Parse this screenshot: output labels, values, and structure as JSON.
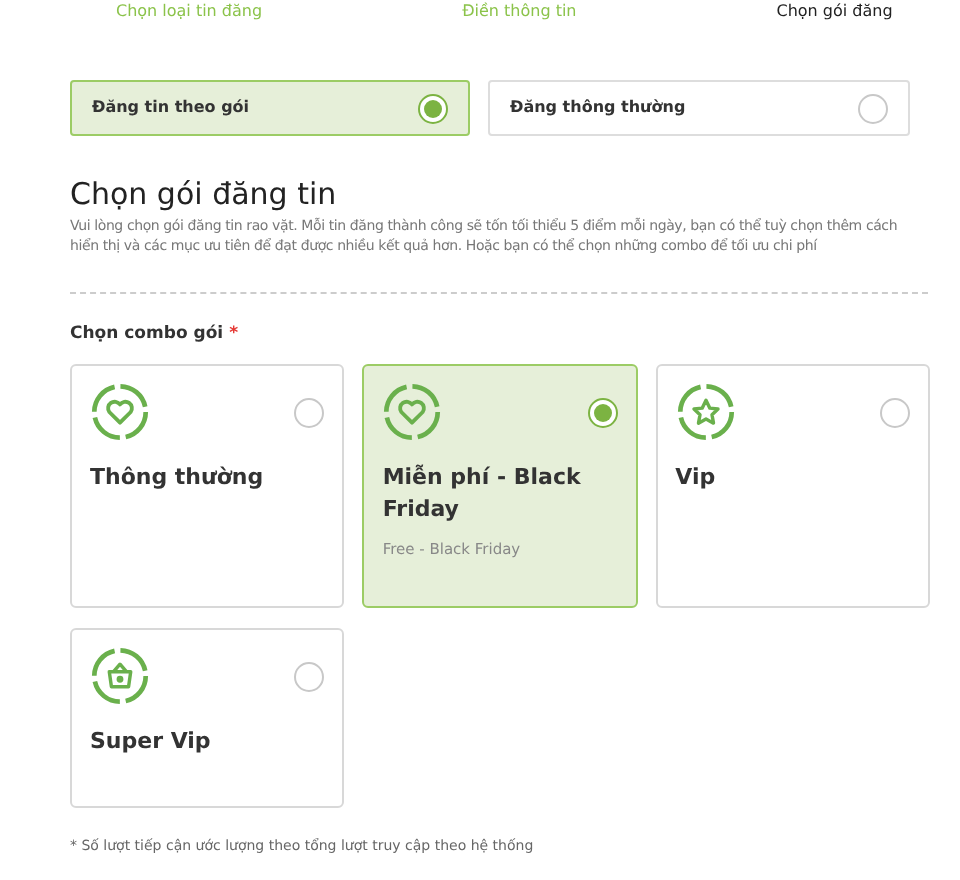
{
  "steps": [
    {
      "label": "Chọn loại tin đăng",
      "selected": false
    },
    {
      "label": "Điền thông tin",
      "selected": false
    },
    {
      "label": "Chọn gói đăng",
      "selected": true
    }
  ],
  "post_types": [
    {
      "label": "Đăng tin theo gói",
      "selected": true
    },
    {
      "label": "Đăng thông thường",
      "selected": false
    }
  ],
  "section": {
    "title": "Chọn gói đăng tin",
    "description": "Vui lòng chọn gói đăng tin rao vặt. Mỗi tin đăng thành công sẽ tốn tối thiểu 5 điểm mỗi ngày, bạn có thể tuỳ chọn thêm cách hiển thị và các mục ưu tiên để đạt được nhiều kết quả hơn. Hoặc bạn có thể chọn những combo để tối ưu chi phí"
  },
  "combo": {
    "label": "Chọn combo gói",
    "required_mark": "*",
    "packages": [
      {
        "name": "Thông thường",
        "kind": "heart",
        "selected": false
      },
      {
        "name": "Miễn phí - Black Friday",
        "subtitle": "Free - Black Friday",
        "kind": "heart",
        "selected": true
      },
      {
        "name": "Vip",
        "kind": "star",
        "selected": false
      },
      {
        "name": "Super Vip",
        "kind": "basket",
        "selected": false
      }
    ]
  },
  "footnote": "* Số lượt tiếp cận ước lượng theo tổng lượt truy cập theo hệ thống"
}
